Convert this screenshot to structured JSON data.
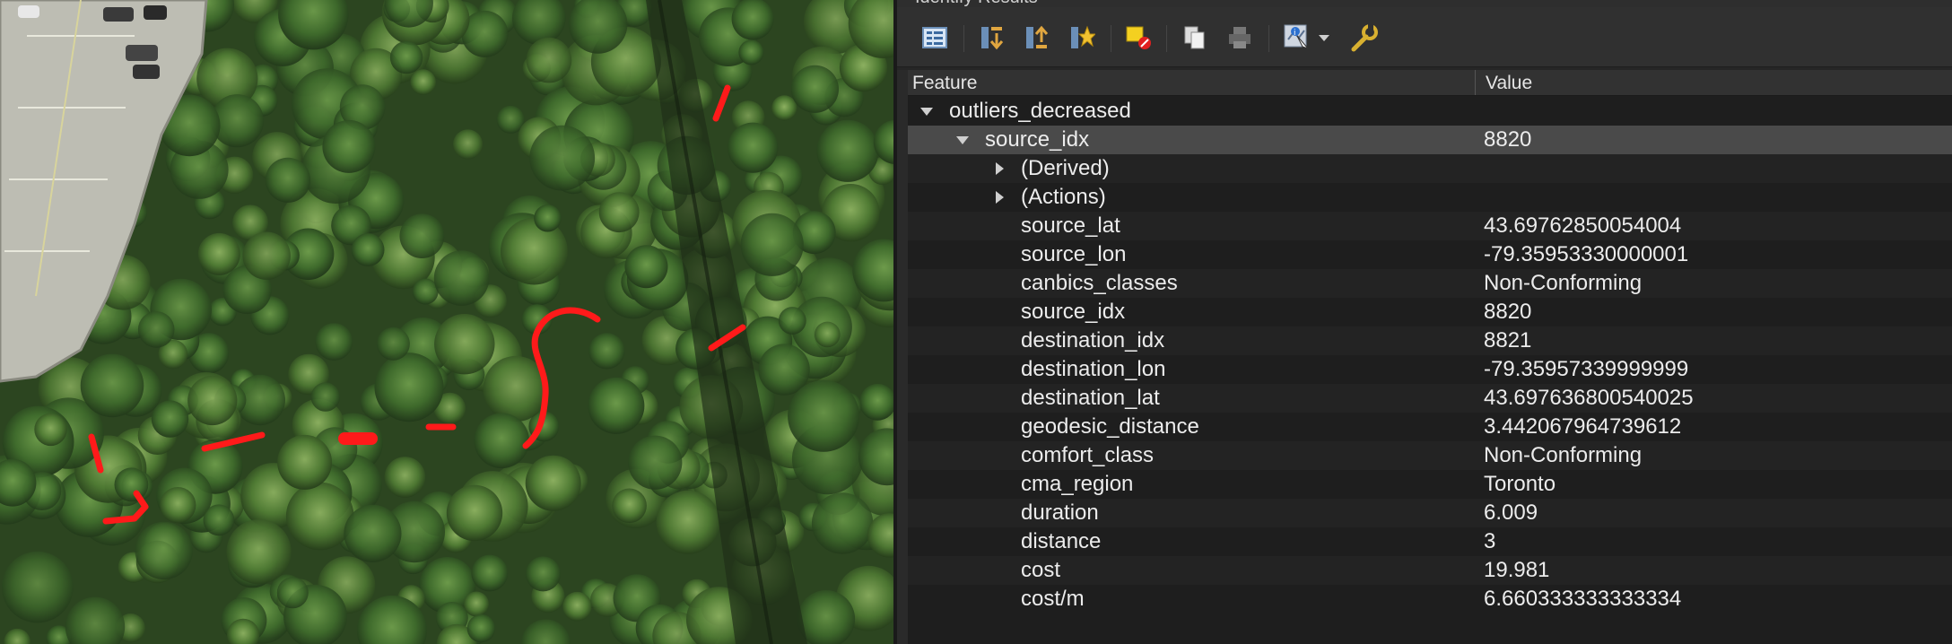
{
  "panel": {
    "title": "Identify Results",
    "columns": {
      "feature": "Feature",
      "value": "Value"
    }
  },
  "toolbar": {
    "icons": [
      "expand-tree-icon",
      "expand-all-icon",
      "collapse-all-icon",
      "highlight-features-icon",
      "clear-highlight-icon",
      "copy-icon",
      "print-icon",
      "identify-mode-icon",
      "dropdown-arrow-icon",
      "settings-icon"
    ]
  },
  "tree": {
    "layer": "outliers_decreased",
    "feature_label": "source_idx",
    "feature_value": "8820",
    "groups": [
      "(Derived)",
      "(Actions)"
    ],
    "attributes": [
      {
        "name": "source_lat",
        "value": "43.69762850054004"
      },
      {
        "name": "source_lon",
        "value": "-79.35953330000001"
      },
      {
        "name": "canbics_classes",
        "value": "Non-Conforming"
      },
      {
        "name": "source_idx",
        "value": "8820"
      },
      {
        "name": "destination_idx",
        "value": "8821"
      },
      {
        "name": "destination_lon",
        "value": "-79.35957339999999"
      },
      {
        "name": "destination_lat",
        "value": "43.697636800540025"
      },
      {
        "name": "geodesic_distance",
        "value": "3.442067964739612"
      },
      {
        "name": "comfort_class",
        "value": "Non-Conforming"
      },
      {
        "name": "cma_region",
        "value": "Toronto"
      },
      {
        "name": "duration",
        "value": "6.009"
      },
      {
        "name": "distance",
        "value": "3"
      },
      {
        "name": "cost",
        "value": "19.981"
      },
      {
        "name": "cost/m",
        "value": "6.660333333333334"
      }
    ]
  },
  "colors": {
    "highlight": "#ff1a1a",
    "selection_row": "#4a4a4a",
    "panel_bg": "#262626"
  }
}
